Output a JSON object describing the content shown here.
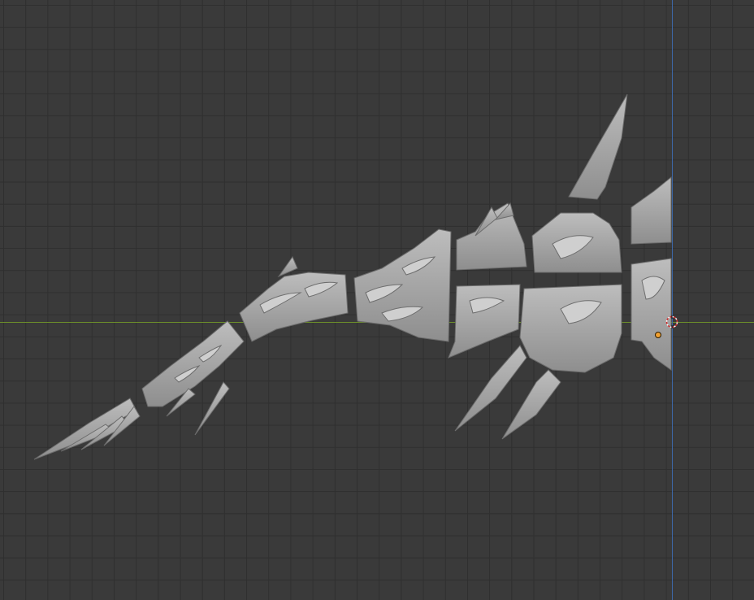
{
  "viewport": {
    "background_color": "#3a3a3a",
    "grid_color": "#2f2f2f",
    "x_axis_color": "#6c8f2a",
    "z_axis_color": "#3d68a8",
    "mesh_color": "#a8a8a8",
    "mesh_shadow_color": "#7c7c7c",
    "origin_color": "#f0a030"
  },
  "icons": {
    "cursor": "3d-cursor-icon",
    "origin": "object-origin-icon"
  }
}
